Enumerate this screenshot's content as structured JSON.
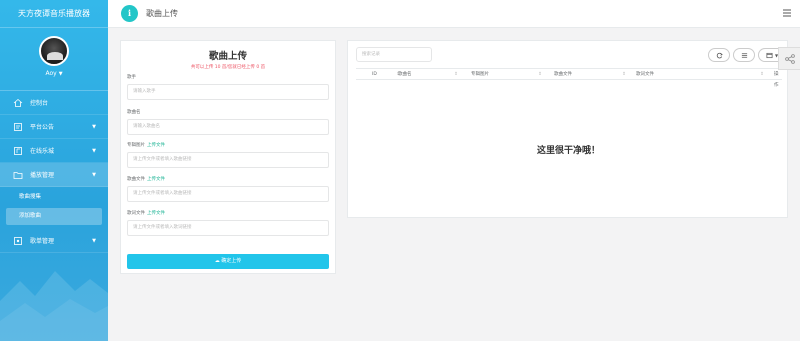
{
  "app": {
    "brand": "天方夜谭音乐播放器"
  },
  "user": {
    "name": "Aoy"
  },
  "nav": {
    "items": [
      {
        "label": "控制台"
      },
      {
        "label": "平台公告"
      },
      {
        "label": "在线乐城"
      },
      {
        "label": "播放管理"
      },
      {
        "label": "歌单管理"
      }
    ],
    "sub_items": [
      {
        "label": "歌曲搜集"
      },
      {
        "label": "添加歌曲"
      }
    ]
  },
  "header": {
    "title": "歌曲上传"
  },
  "upload": {
    "title": "歌曲上传",
    "subtitle": "共可以上传 10 首/您就已经上传 0 首",
    "fields": [
      {
        "label": "歌手",
        "placeholder": "请输入歌手"
      },
      {
        "label": "歌曲名",
        "placeholder": "请输入歌曲名"
      },
      {
        "label": "专辑图片",
        "link": "上传文件",
        "placeholder": "请上传文件或者填入歌曲链接"
      },
      {
        "label": "歌曲文件",
        "link": "上传文件",
        "placeholder": "请上传文件或者填入歌曲链接"
      },
      {
        "label": "歌词文件",
        "link": "上传文件",
        "placeholder": "请上传文件或者填入歌词链接"
      }
    ],
    "submit": "确定上传"
  },
  "table": {
    "search_placeholder": "搜索记录",
    "columns": [
      "ID",
      "歌曲名",
      "专辑图片",
      "歌曲文件",
      "歌词文件",
      "操作"
    ],
    "empty_text": "这里很干净哦！"
  },
  "colors": {
    "sidebar": "#2aa3dc",
    "accent": "#22c5ea",
    "info": "#23c6c8",
    "warning_text": "#ed5565",
    "link": "#1ab394"
  }
}
